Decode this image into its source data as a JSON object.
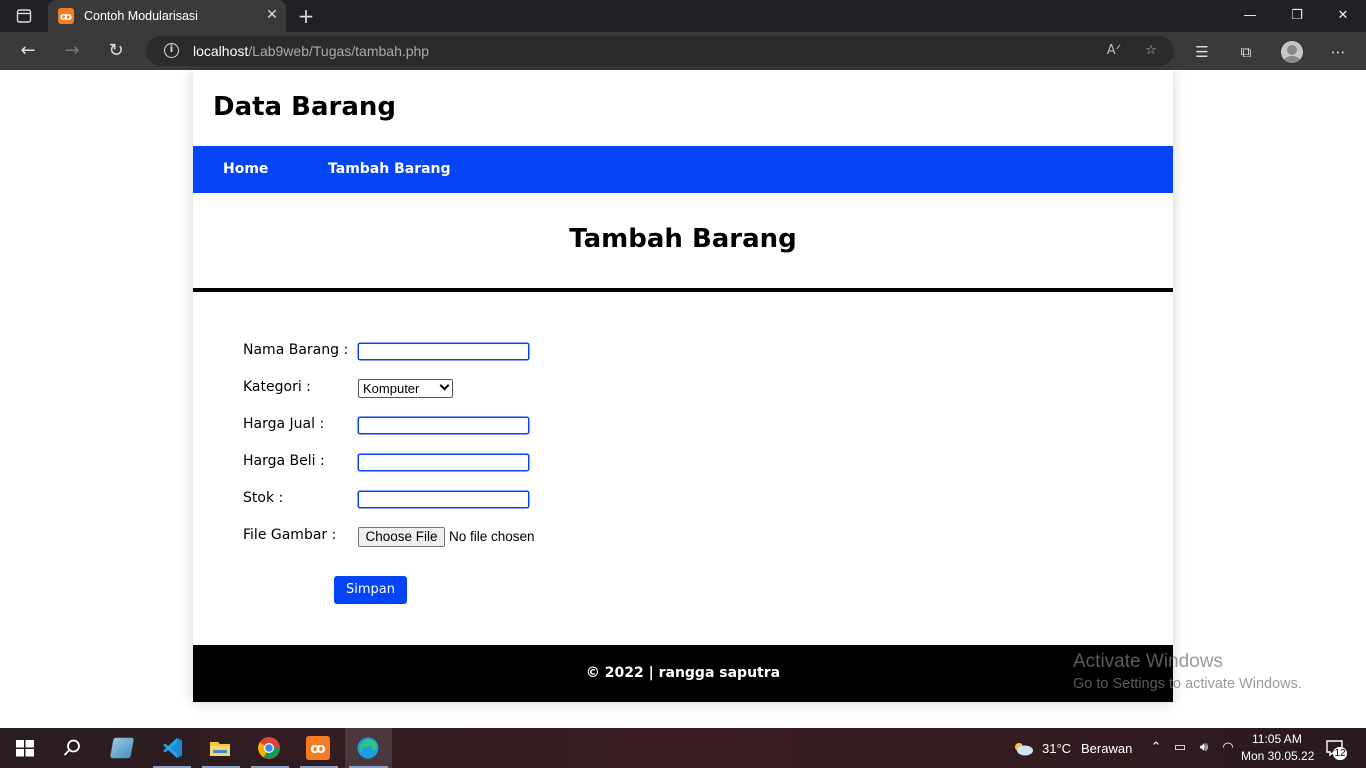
{
  "browser": {
    "tab_title": "Contoh Modularisasi",
    "tab_favicon": "xampp-icon",
    "url_host": "localhost",
    "url_path": "/Lab9web/Tugas/tambah.php",
    "new_tab_symbol": "+",
    "close_symbol": "✕"
  },
  "page": {
    "site_title": "Data Barang",
    "nav": [
      {
        "label": "Home"
      },
      {
        "label": "Tambah Barang"
      }
    ],
    "heading": "Tambah Barang",
    "form": {
      "nama_label": "Nama Barang :",
      "nama_value": "",
      "kategori_label": "Kategori :",
      "kategori_value": "Komputer",
      "harga_jual_label": "Harga Jual :",
      "harga_jual_value": "",
      "harga_beli_label": "Harga Beli :",
      "harga_beli_value": "",
      "stok_label": "Stok :",
      "stok_value": "",
      "file_label": "File Gambar :",
      "file_button": "Choose File",
      "file_status": "No file chosen",
      "submit": "Simpan"
    },
    "footer": "© 2022 | rangga saputra"
  },
  "watermark": {
    "line1": "Activate Windows",
    "line2": "Go to Settings to activate Windows."
  },
  "taskbar": {
    "temperature": "31°C",
    "weather": "Berawan",
    "time": "11:05 AM",
    "date": "Mon 30.05.22",
    "notification_count": "12"
  },
  "colors": {
    "accent": "#0645f5",
    "footer_bg": "#000000"
  }
}
